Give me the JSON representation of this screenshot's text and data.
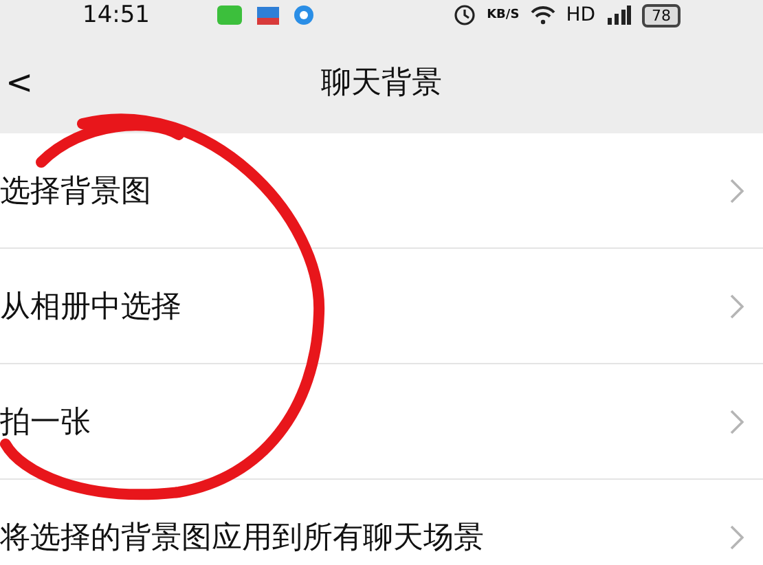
{
  "status_bar": {
    "time": "14:51",
    "speed_unit": "KB/S",
    "network": "HD",
    "battery": "78"
  },
  "header": {
    "back": "<",
    "title": "聊天背景"
  },
  "items": [
    {
      "label": "选择背景图"
    },
    {
      "label": "从相册中选择"
    },
    {
      "label": "拍一张"
    },
    {
      "label": "将选择的背景图应用到所有聊天场景"
    }
  ]
}
